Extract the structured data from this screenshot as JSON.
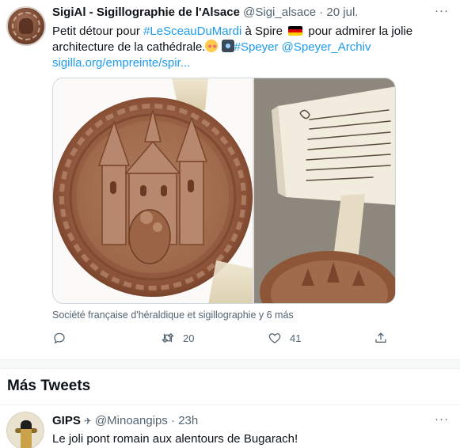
{
  "tweet": {
    "author_name": "SigiAl - Sigillographie de l'Alsace",
    "handle": "@Sigi_alsace",
    "separator": "·",
    "time": "20 jul.",
    "more": "···",
    "text": {
      "part1": "Petit détour pour ",
      "hashtag_sceau": "#LeSceauDuMardi",
      "part2": " à Spire ",
      "part3": " pour admirer la jolie architecture de la cathédrale.",
      "hashtag_speyer": "#Speyer",
      "mention": "@Speyer_Archiv",
      "link": "sigilla.org/empreinte/spir..."
    },
    "emoji_icons": [
      "german-flag-icon",
      "star-struck-icon",
      "camera-icon"
    ],
    "media_caption": "Société française d'héraldique et sigillographie y 6 más",
    "actions": {
      "reply_count": "",
      "retweet_count": "20",
      "like_count": "41"
    }
  },
  "more_tweets": {
    "title": "Más Tweets"
  },
  "tweet2": {
    "author_name": "GIPS",
    "badge": "✈",
    "handle": "@Minoangips",
    "separator": "·",
    "time": "23h",
    "more": "···",
    "text": "Le joli pont romain aux alentours de Bugarach!"
  },
  "colors": {
    "link": "#1d9bf0",
    "secondary_text": "#536471",
    "primary_text": "#0f1419"
  }
}
